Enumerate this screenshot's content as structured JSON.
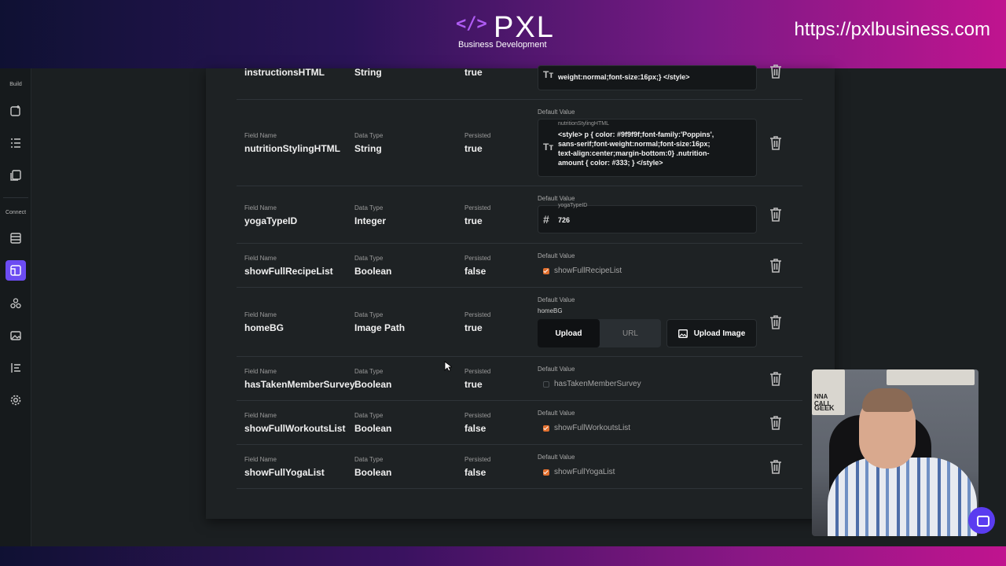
{
  "banner": {
    "logo_mark": "</>",
    "logo_text": "PXL",
    "logo_sub": "Business Development",
    "url": "https://pxlbusiness.com"
  },
  "sidebar": {
    "build_label": "Build",
    "connect_label": "Connect",
    "icons": [
      "add-screen-icon",
      "list-icon",
      "pages-icon",
      "database-icon",
      "app-variables-icon",
      "integrations-icon",
      "media-icon",
      "logic-icon",
      "settings-icon"
    ]
  },
  "labels": {
    "field_name": "Field Name",
    "data_type": "Data Type",
    "persisted": "Persisted",
    "default_value": "Default Value"
  },
  "fields": [
    {
      "name": "instructionsHTML",
      "type": "String",
      "persisted": "true",
      "default_text": "weight:normal;font-size:16px;} </style>",
      "icon": "text-icon"
    },
    {
      "name": "nutritionStylingHTML",
      "type": "String",
      "persisted": "true",
      "float_label": "nutritionStylingHTML",
      "default_lines": [
        "<style> p { color: #9f9f9f;font-family:'Poppins',",
        "sans-serif;font-weight:normal;font-size:16px;",
        "text-align:center;margin-bottom:0} .nutrition-",
        "amount { color: #333; } </style>"
      ],
      "icon": "text-icon"
    },
    {
      "name": "yogaTypeID",
      "type": "Integer",
      "persisted": "true",
      "float_label": "yogaTypeID",
      "default_text": "726",
      "icon": "hash-icon"
    },
    {
      "name": "showFullRecipeList",
      "type": "Boolean",
      "persisted": "false",
      "checked": true,
      "check_label": "showFullRecipeList"
    },
    {
      "name": "homeBG",
      "type": "Image Path",
      "persisted": "true",
      "sub_label": "homeBG",
      "upload_label": "Upload",
      "url_label": "URL",
      "upload_image_label": "Upload Image"
    },
    {
      "name": "hasTakenMemberSurvey",
      "type": "Boolean",
      "persisted": "true",
      "checked": false,
      "check_label": "hasTakenMemberSurvey"
    },
    {
      "name": "showFullWorkoutsList",
      "type": "Boolean",
      "persisted": "false",
      "checked": true,
      "check_label": "showFullWorkoutsList"
    },
    {
      "name": "showFullYogaList",
      "type": "Boolean",
      "persisted": "false",
      "checked": true,
      "check_label": "showFullYogaList"
    }
  ],
  "webcam": {
    "sign_top": "GEEK",
    "sign_mid": "NNA CALL"
  },
  "colors": {
    "accent": "#6c4cf2",
    "checkbox": "#e2702f",
    "panel": "#1e2224"
  }
}
